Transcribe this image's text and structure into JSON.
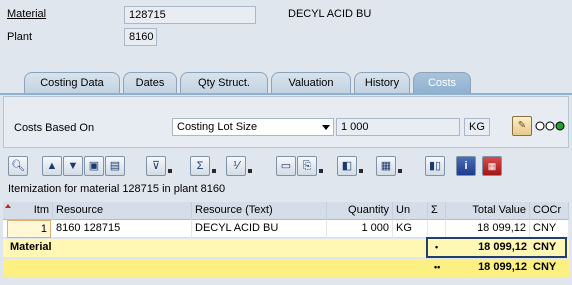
{
  "header": {
    "material_label": "Material",
    "material_value": "128715",
    "material_desc": "DECYL ACID BU",
    "plant_label": "Plant",
    "plant_value": "8160"
  },
  "tabs": [
    {
      "label": "Costing Data",
      "active": false
    },
    {
      "label": "Dates",
      "active": false
    },
    {
      "label": "Qty Struct.",
      "active": false
    },
    {
      "label": "Valuation",
      "active": false
    },
    {
      "label": "History",
      "active": false
    },
    {
      "label": "Costs",
      "active": true
    }
  ],
  "costs_panel": {
    "costs_based_on_label": "Costs Based On",
    "costs_based_on_value": "Costing Lot Size",
    "lot_size_value": "1 000",
    "unit_value": "KG"
  },
  "toolbar": {
    "icons": [
      "details-icon",
      "print-icon",
      "filter-icon",
      "find-icon",
      "filter-dropdown-icon",
      "sum-icon",
      "subtotal-icon",
      "print-preview-icon",
      "export-icon",
      "layout-icon",
      "layout-select-icon",
      "chart-icon",
      "info-icon",
      "documents-icon"
    ]
  },
  "itemization_title": "Itemization for material 128715 in plant 8160",
  "table": {
    "columns": [
      "Itm",
      "Resource",
      "Resource (Text)",
      "Quantity",
      "Un",
      "Σ",
      "Total Value",
      "COCr"
    ],
    "rows": [
      {
        "itm": "1",
        "resource": "8160 128715",
        "resource_text": "DECYL ACID BU",
        "quantity": "1 000",
        "un": "KG",
        "sigma": "",
        "total_value": "18 099,12",
        "cocr": "CNY"
      }
    ],
    "subtotal": {
      "label": "Material",
      "sigma": "•",
      "total_value": "18 099,12",
      "cocr": "CNY"
    },
    "total": {
      "sigma": "••",
      "total_value": "18 099,12",
      "cocr": "CNY"
    }
  }
}
